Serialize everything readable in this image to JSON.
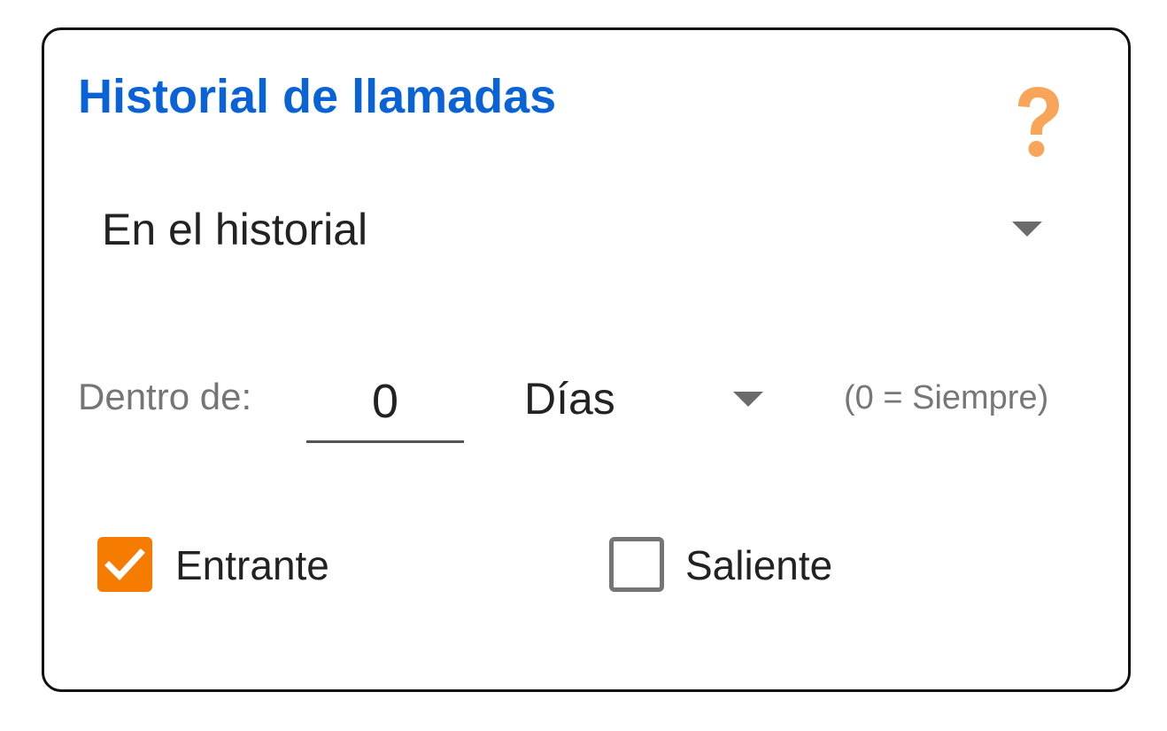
{
  "card": {
    "title": "Historial de llamadas",
    "help_icon": "question-mark-icon"
  },
  "history_dropdown": {
    "selected": "En el historial"
  },
  "filter": {
    "within_label": "Dentro de:",
    "days_value": "0",
    "unit_selected": "Días",
    "hint": "(0 = Siempre)"
  },
  "checkboxes": {
    "incoming": {
      "label": "Entrante",
      "checked": true
    },
    "outgoing": {
      "label": "Saliente",
      "checked": false
    }
  },
  "colors": {
    "title": "#0a63d6",
    "accent": "#f57c00",
    "help_icon": "#f8a55a"
  }
}
